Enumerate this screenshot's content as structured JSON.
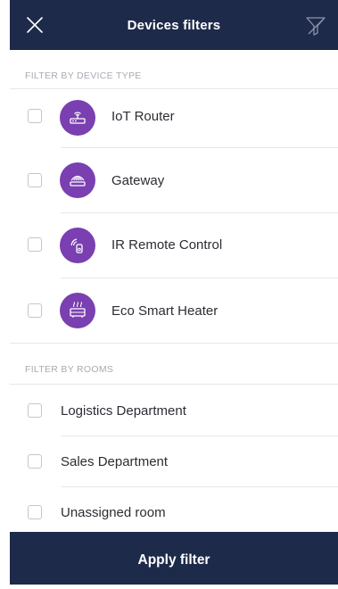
{
  "colors": {
    "header_bg": "#1e2a4a",
    "accent": "#7a3fb0",
    "divider": "#e6e7ea"
  },
  "header": {
    "title": "Devices filters",
    "close_icon": "close-icon",
    "clear_icon": "filter-clear-icon"
  },
  "device_types": {
    "label": "FILTER BY DEVICE TYPE",
    "items": [
      {
        "label": "IoT Router",
        "icon": "router-icon",
        "checked": false
      },
      {
        "label": "Gateway",
        "icon": "gateway-icon",
        "checked": false
      },
      {
        "label": "IR Remote Control",
        "icon": "ir-remote-icon",
        "checked": false
      },
      {
        "label": "Eco Smart Heater",
        "icon": "heater-icon",
        "checked": false
      }
    ]
  },
  "rooms": {
    "label": "FILTER BY ROOMS",
    "items": [
      {
        "label": "Logistics Department",
        "checked": false
      },
      {
        "label": "Sales Department",
        "checked": false
      },
      {
        "label": "Unassigned room",
        "checked": false
      }
    ]
  },
  "footer": {
    "apply_label": "Apply filter"
  }
}
